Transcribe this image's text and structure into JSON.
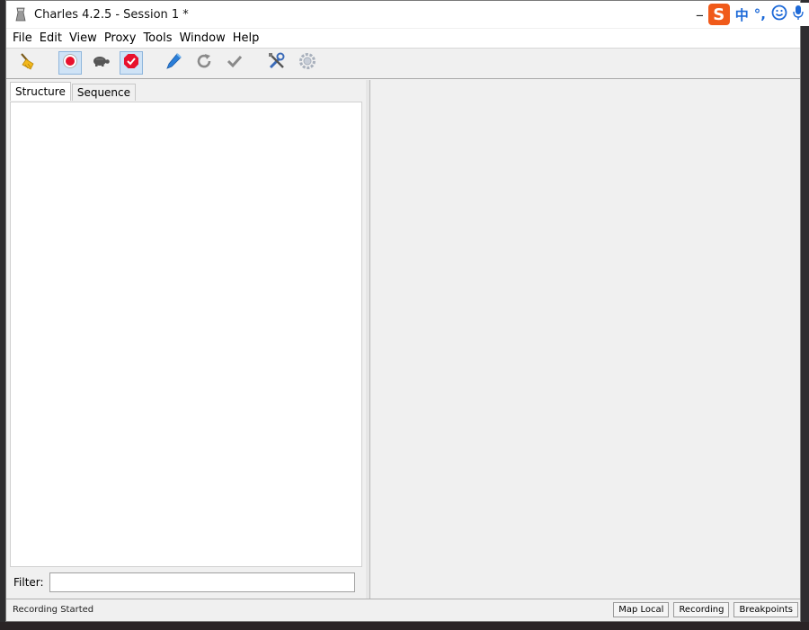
{
  "window": {
    "title": "Charles 4.2.5 - Session 1 *",
    "minimize_glyph": "—"
  },
  "ime": {
    "logo": "S",
    "lang": "中",
    "punct": "°,",
    "emoji_icon": "smiley-icon",
    "mic_icon": "microphone-icon"
  },
  "menubar": {
    "items": [
      {
        "label": "File"
      },
      {
        "label": "Edit"
      },
      {
        "label": "View"
      },
      {
        "label": "Proxy"
      },
      {
        "label": "Tools"
      },
      {
        "label": "Window"
      },
      {
        "label": "Help"
      }
    ]
  },
  "toolbar": {
    "buttons": [
      {
        "icon": "broom-icon",
        "active": false
      },
      {
        "icon": "record-icon",
        "active": true
      },
      {
        "icon": "turtle-icon",
        "active": false
      },
      {
        "icon": "breakpoint-icon",
        "active": true
      },
      {
        "icon": "pen-icon",
        "active": false
      },
      {
        "icon": "refresh-icon",
        "active": false
      },
      {
        "icon": "check-icon",
        "active": false
      },
      {
        "icon": "tools-icon",
        "active": false
      },
      {
        "icon": "gear-icon",
        "active": false
      }
    ],
    "colors": {
      "record": "#e8112d",
      "accent": "#1e6ad8"
    }
  },
  "left_pane": {
    "tabs": [
      {
        "label": "Structure",
        "selected": true
      },
      {
        "label": "Sequence",
        "selected": false
      }
    ],
    "filter_label": "Filter:",
    "filter_value": ""
  },
  "statusbar": {
    "text": "Recording Started",
    "buttons": [
      {
        "label": "Map Local"
      },
      {
        "label": "Recording"
      },
      {
        "label": "Breakpoints"
      }
    ]
  }
}
